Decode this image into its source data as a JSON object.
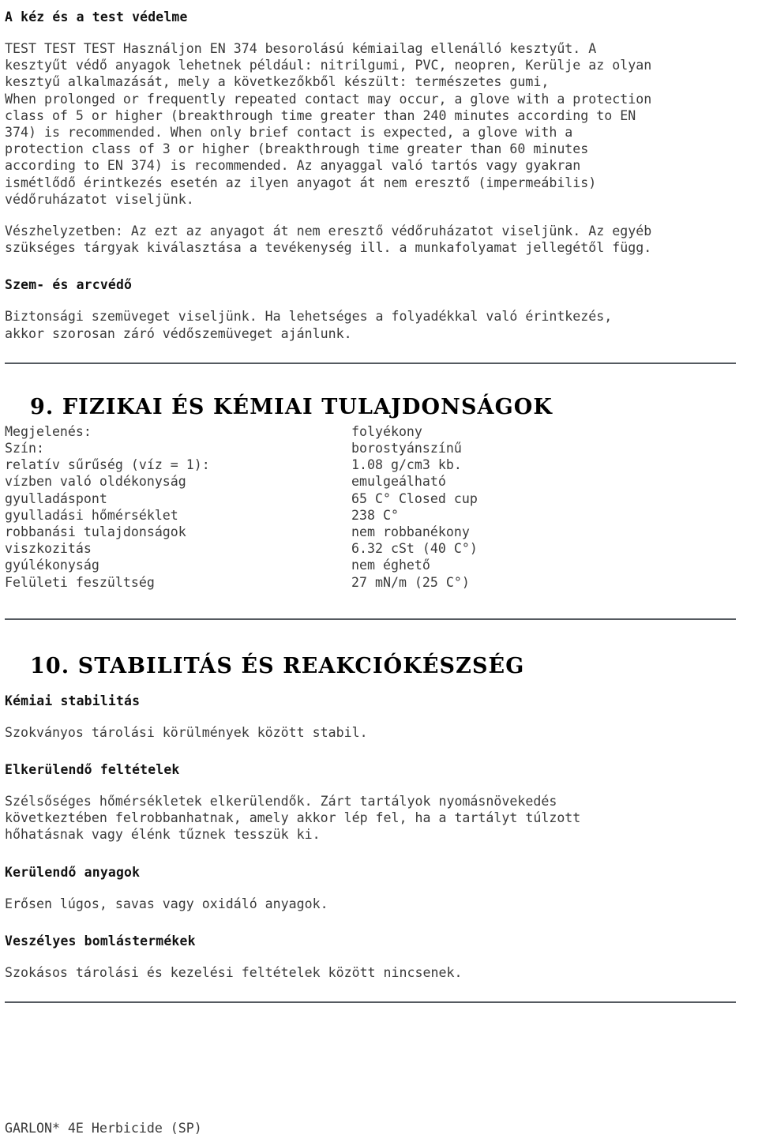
{
  "document": {
    "title": "A kéz és a test védelme",
    "footer": "GARLON* 4E Herbicide (SP)",
    "rule_color": "#555a60"
  },
  "hand_body_protection": {
    "heading": "A kéz és a test védelme",
    "paragraph_1": "TEST TEST TEST Használjon EN 374 besorolású kémiailag ellenálló kesztyűt. A\nkesztyűt védő anyagok lehetnek például: nitrilgumi, PVC, neopren, Kerülje az olyan\nkesztyű alkalmazását, mely a következőkből készült: természetes gumi,\nWhen prolonged or frequently repeated contact may occur, a glove with a protection\nclass of 5 or higher (breakthrough time greater than 240 minutes according to EN\n374) is recommended. When only brief contact is expected, a glove with a\nprotection class of 3 or higher (breakthrough time greater than 60 minutes\naccording to EN 374) is recommended. Az anyaggal való tartós vagy gyakran\nismétlődő érintkezés esetén az ilyen anyagot át nem eresztő (impermeábilis)\nvédőruházatot viseljünk.",
    "paragraph_2": "Vészhelyzetben: Az ezt az anyagot át nem eresztő védőruházatot viseljünk. Az egyéb\nszükséges tárgyak kiválasztása a tevékenység ill. a munkafolyamat jellegétől függ."
  },
  "eye_face_protection": {
    "heading": "Szem- és arcvédő",
    "paragraph": "Biztonsági szemüveget viseljünk. Ha lehetséges a folyadékkal való érintkezés,\nakkor szorosan záró védőszemüveget ajánlunk."
  },
  "section_9": {
    "title": "9. FIZIKAI ÉS KÉMIAI TULAJDONSÁGOK",
    "properties": [
      {
        "label": "Megjelenés:",
        "value": "folyékony"
      },
      {
        "label": "Szín:",
        "value": "borostyánszínű"
      },
      {
        "label": "relatív sűrűség (víz = 1):",
        "value": "1.08 g/cm3 kb."
      },
      {
        "label": "vízben való oldékonyság",
        "value": "emulgeálható"
      },
      {
        "label": "gyulladáspont",
        "value": "65 C° Closed cup"
      },
      {
        "label": "gyulladási hőmérséklet",
        "value": "238 C°"
      },
      {
        "label": "robbanási tulajdonságok",
        "value": "nem robbanékony"
      },
      {
        "label": "viszkozitás",
        "value": "6.32 cSt (40 C°)"
      },
      {
        "label": "gyúlékonyság",
        "value": "nem éghető"
      },
      {
        "label": "Felületi feszültség",
        "value": "27 mN/m (25 C°)"
      }
    ]
  },
  "section_10": {
    "title": "10. STABILITÁS ÉS REAKCIÓKÉSZSÉG",
    "chemical_stability": {
      "heading": "Kémiai stabilitás",
      "text": "Szokványos tárolási körülmények között stabil."
    },
    "conditions_to_avoid": {
      "heading": "Elkerülendő feltételek",
      "text": "Szélsőséges hőmérsékletek elkerülendők. Zárt tartályok nyomásnövekedés\nkövetkeztében felrobbanhatnak, amely akkor lép fel, ha a tartályt túlzott\nhőhatásnak vagy élénk tűznek tesszük ki."
    },
    "materials_to_avoid": {
      "heading": "Kerülendő anyagok",
      "text": "Erősen lúgos, savas vagy oxidáló anyagok."
    },
    "hazardous_decomposition": {
      "heading": "Veszélyes bomlástermékek",
      "text": "Szokásos tárolási és kezelési feltételek között nincsenek."
    }
  }
}
